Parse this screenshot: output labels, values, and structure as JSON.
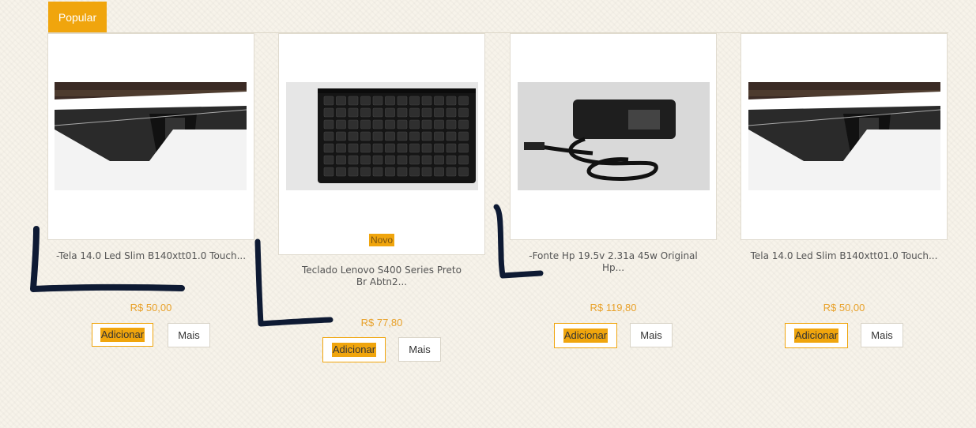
{
  "tabs": {
    "popular_label": "Popular"
  },
  "products": [
    {
      "title": "-Tela 14.0 Led Slim B140xtt01.0 Touch...",
      "price": "R$ 50,00",
      "add_label": "Adicionar",
      "more_label": "Mais",
      "image": "laptop-screen-photo"
    },
    {
      "title": "Teclado Lenovo S400 Series Preto Br Abtn2...",
      "price": "R$ 77,80",
      "add_label": "Adicionar",
      "more_label": "Mais",
      "badge": "Novo",
      "image": "keyboard-photo"
    },
    {
      "title": "-Fonte Hp 19.5v 2.31a 45w Original Hp...",
      "price": "R$ 119,80",
      "add_label": "Adicionar",
      "more_label": "Mais",
      "image": "power-adapter-photo"
    },
    {
      "title": "Tela 14.0 Led Slim B140xtt01.0 Touch...",
      "price": "R$ 50,00",
      "add_label": "Adicionar",
      "more_label": "Mais",
      "image": "laptop-screen-photo"
    }
  ],
  "colors": {
    "accent": "#f0a50d",
    "price": "#e8a12a",
    "annotation_ink": "#0e1a33"
  }
}
